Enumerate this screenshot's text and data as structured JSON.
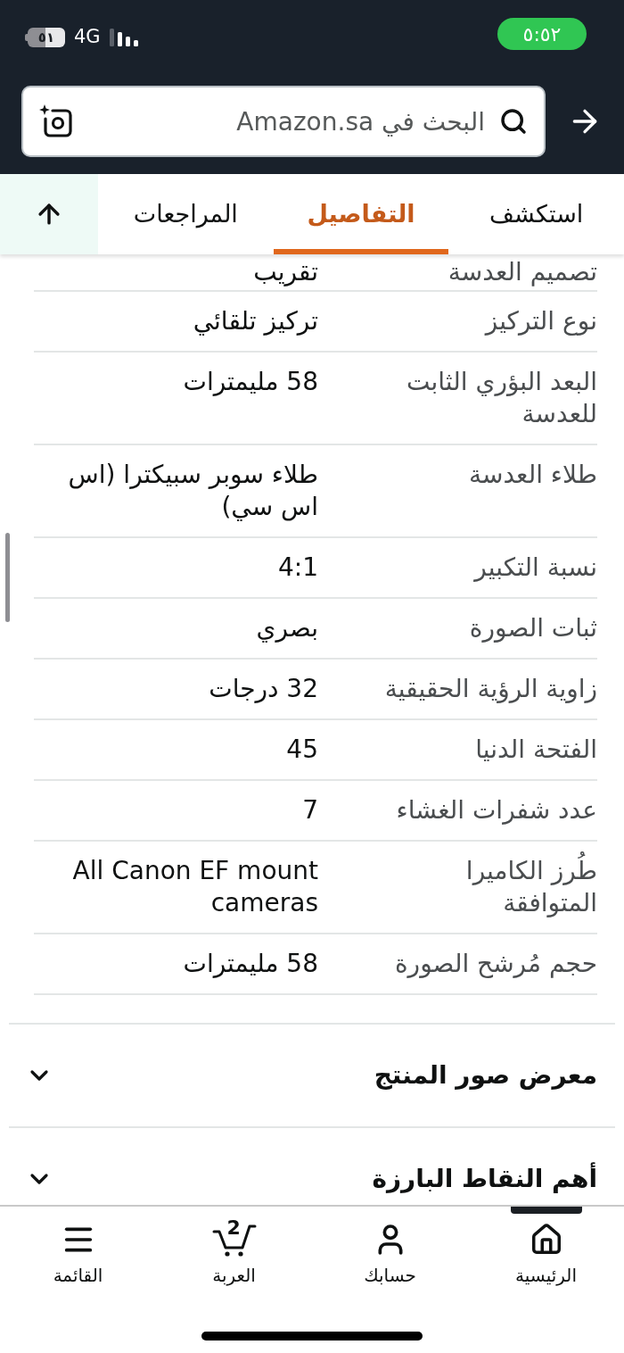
{
  "status_bar": {
    "time": "٥:٥٢",
    "battery": "٥١",
    "network": "4G"
  },
  "search": {
    "placeholder": "البحث في Amazon.sa"
  },
  "tabs": [
    {
      "label": "استكشف",
      "selected": false
    },
    {
      "label": "التفاصيل",
      "selected": true
    },
    {
      "label": "المراجعات",
      "selected": false
    }
  ],
  "details": [
    {
      "label": "تصميم العدسة",
      "value": "تقريب"
    },
    {
      "label": "نوع التركيز",
      "value": "تركيز تلقائي"
    },
    {
      "label": "البعد البؤري الثابت للعدسة",
      "value": "58 مليمترات"
    },
    {
      "label": "طلاء العدسة",
      "value": "طلاء سوبر سبيكترا (اس اس سي)"
    },
    {
      "label": "نسبة التكبير",
      "value": "4:1"
    },
    {
      "label": "ثبات الصورة",
      "value": "بصري"
    },
    {
      "label": "زاوية الرؤية الحقيقية",
      "value": "32 درجات"
    },
    {
      "label": "الفتحة الدنيا",
      "value": "45"
    },
    {
      "label": "عدد شفرات الغشاء",
      "value": "7"
    },
    {
      "label": "طُرز الكاميرا المتوافقة",
      "value": "All Canon EF mount cameras"
    },
    {
      "label": "حجم مُرشح الصورة",
      "value": "58 مليمترات"
    }
  ],
  "sections": [
    {
      "title": "معرض صور المنتج",
      "expanded": false
    },
    {
      "title": "أهم النقاط البارزة",
      "expanded": false
    }
  ],
  "nav": [
    {
      "label": "الرئيسية",
      "selected": true
    },
    {
      "label": "حسابك",
      "selected": false
    },
    {
      "label": "العربة",
      "selected": false,
      "count": "2"
    },
    {
      "label": "القائمة",
      "selected": false
    }
  ]
}
